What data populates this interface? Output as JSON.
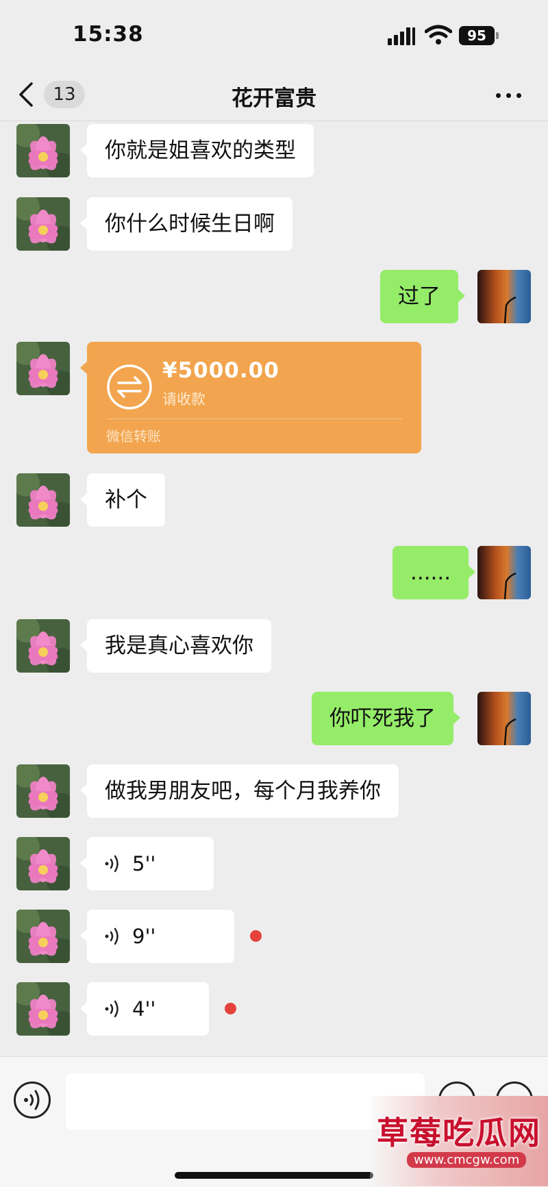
{
  "status_bar": {
    "time": "15:38",
    "battery": "95"
  },
  "nav": {
    "unread_count": "13",
    "title": "花开富贵"
  },
  "messages": [
    {
      "text": "你就是姐喜欢的类型"
    },
    {
      "text": "你什么时候生日啊"
    },
    {
      "text": "过了"
    },
    {
      "transfer_amount": "¥5000.00",
      "transfer_status": "请收款",
      "transfer_source": "微信转账"
    },
    {
      "text": "补个"
    },
    {
      "text": "......"
    },
    {
      "text": "我是真心喜欢你"
    },
    {
      "text": "你吓死我了"
    },
    {
      "text": "做我男朋友吧，每个月我养你"
    },
    {
      "duration": "5''"
    },
    {
      "duration": "9''"
    },
    {
      "duration": "4''"
    }
  ],
  "watermark": {
    "main": "草莓吃瓜网",
    "sub": "www.cmcgw.com"
  },
  "colors": {
    "background": "#ededed",
    "outgoing_bubble": "#95ec69",
    "transfer_card": "#f2a54e",
    "unread_dot": "#e5423c"
  }
}
